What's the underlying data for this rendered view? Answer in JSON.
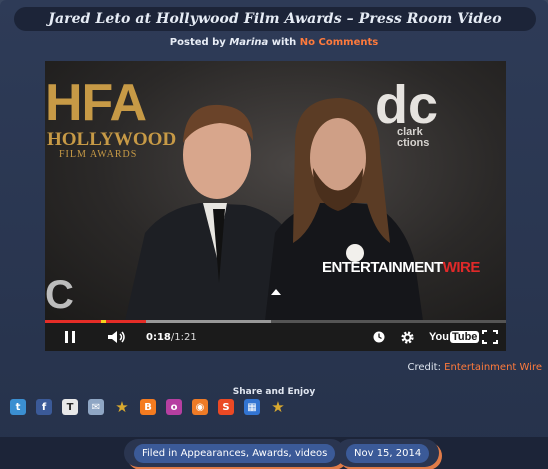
{
  "post": {
    "title": "Jared Leto at Hollywood Film Awards – Press Room Video",
    "byline_prefix": "Posted by",
    "author": "Marina",
    "byline_with": "with",
    "comments_link": "No Comments"
  },
  "video": {
    "backdrop": {
      "hfa_logo": "HFA",
      "hfa_line1": "HOLLYWOOD",
      "hfa_line2": "FILM AWARDS",
      "dc_logo": "dc",
      "dc_line1": "clark",
      "dc_line2": "ctions",
      "cbs_mark": "C"
    },
    "watermark_white": "ENTERTAINMENT",
    "watermark_red": "WIRE",
    "current_time": "0:18",
    "separator": " / ",
    "duration": "1:21",
    "played_fraction": 0.22,
    "loaded_fraction": 0.49,
    "youtube_label_1": "You",
    "youtube_label_2": "Tube",
    "icons": {
      "play_pause": "pause-icon",
      "volume": "volume-icon",
      "watch_later": "clock-icon",
      "settings": "gear-icon",
      "fullscreen": "fullscreen-icon"
    }
  },
  "credit": {
    "label": "Credit:",
    "source": "Entertainment Wire"
  },
  "share": {
    "title": "Share and Enjoy",
    "services": [
      {
        "name": "twitter",
        "glyph": "t",
        "color": "#3b8fd1"
      },
      {
        "name": "facebook",
        "glyph": "f",
        "color": "#3b5a98"
      },
      {
        "name": "technorati",
        "glyph": "T",
        "color": "#e8e8e8"
      },
      {
        "name": "email",
        "glyph": "✉",
        "color": "#8fa6c4"
      },
      {
        "name": "favorite",
        "glyph": "★",
        "color": "#d9a92f"
      },
      {
        "name": "blogger",
        "glyph": "B",
        "color": "#f47b20"
      },
      {
        "name": "orkut",
        "glyph": "o",
        "color": "#b63fa1"
      },
      {
        "name": "rss",
        "glyph": "◉",
        "color": "#ef7b26"
      },
      {
        "name": "stumbleupon",
        "glyph": "S",
        "color": "#eb4924"
      },
      {
        "name": "delicious",
        "glyph": "▦",
        "color": "#3274d2"
      },
      {
        "name": "bookmark",
        "glyph": "★",
        "color": "#d9a92f"
      }
    ]
  },
  "footer": {
    "filed_in_label": "Filed in",
    "categories": [
      "Appearances",
      "Awards",
      "videos"
    ],
    "date": "Nov 15, 2014"
  }
}
